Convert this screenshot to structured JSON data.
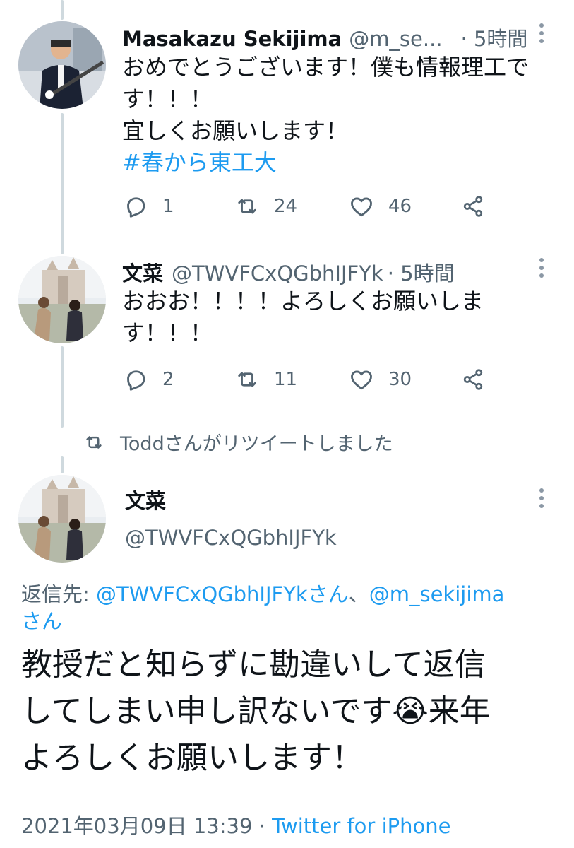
{
  "tweet1": {
    "name": "Masakazu Sekijima",
    "handle": "@m_se...",
    "time": "· 5時間",
    "line1": "おめでとうございます！僕も情報理工で",
    "line2": "す！！！",
    "line3": "宜しくお願いします！",
    "hashtag": "#春から東工大",
    "replies": "1",
    "retweets": "24",
    "likes": "46"
  },
  "tweet2": {
    "name": "文菜",
    "handle": "@TWVFCxQGbhIJFYk",
    "time": "· 5時間",
    "line1": "おおお！！！！よろしくお願いしま",
    "line2": "す！！！",
    "replies": "2",
    "retweets": "11",
    "likes": "30"
  },
  "retweet_notice": "Toddさんがリツイートしました",
  "main": {
    "name": "文菜",
    "handle": "@TWVFCxQGbhIJFYk",
    "reply_prefix": "返信先: ",
    "reply_mention1": "@TWVFCxQGbhIJFYkさん",
    "reply_sep": "、",
    "reply_mention2": "@m_sekijima",
    "reply_mention2_suffix": "さん",
    "line1": "教授だと知らずに勘違いして返信",
    "line2_before": "してしまい申し訳ないです",
    "line2_emoji": "😭",
    "line2_after": "来年",
    "line3": "よろしくお願いします！",
    "date": "2021年03月09日 13:39",
    "sep": " · ",
    "source": "Twitter for iPhone"
  },
  "icons": {
    "reply": "reply-icon",
    "retweet": "retweet-icon",
    "like": "heart-icon",
    "share": "share-icon",
    "more": "more-icon"
  },
  "colors": {
    "accent": "#1d9bf0",
    "secondary_text": "#536471",
    "thread_line": "#cfd9de"
  }
}
